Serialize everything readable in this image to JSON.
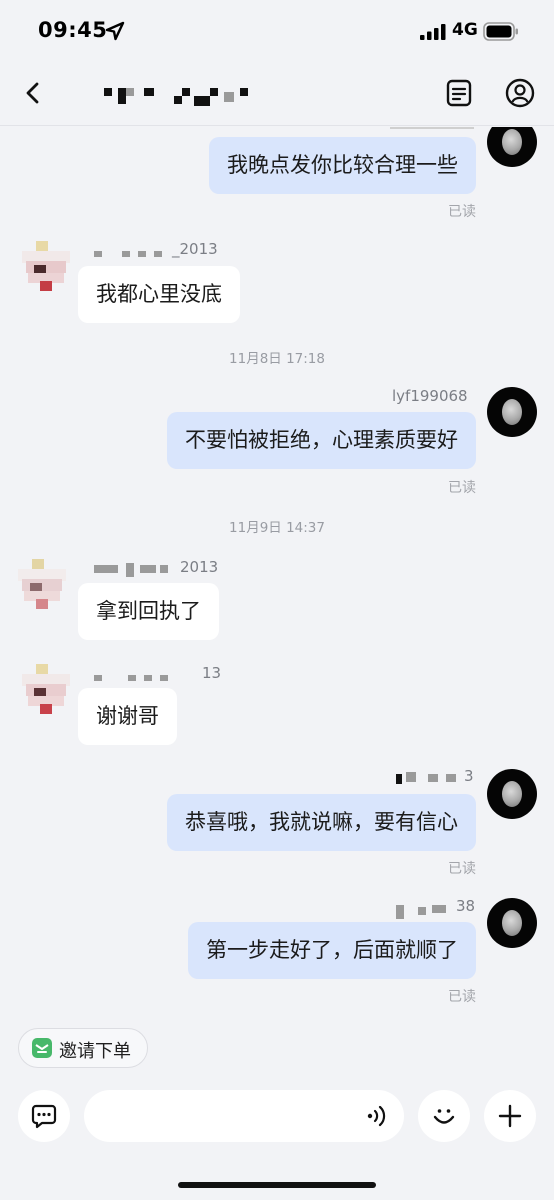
{
  "status_bar": {
    "time": "09:45",
    "network": "4G"
  },
  "chat": {
    "messages": [
      {
        "text": "我晚点发你比较合理一些",
        "status": "已读"
      },
      {
        "sender": "_2013",
        "text": "我都心里没底"
      },
      {
        "timestamp": "11月8日 17:18"
      },
      {
        "sender": "lyf199068",
        "text": "不要怕被拒绝，心理素质要好",
        "status": "已读"
      },
      {
        "timestamp": "11月9日 14:37"
      },
      {
        "sender": "2013",
        "text": "拿到回执了"
      },
      {
        "sender": "13",
        "text": "谢谢哥"
      },
      {
        "sender": "3",
        "text": "恭喜哦，我就说嘛，要有信心",
        "status": "已读"
      },
      {
        "sender": "38",
        "text": "第一步走好了，后面就顺了",
        "status": "已读"
      }
    ]
  },
  "bottom": {
    "invite_label": "邀请下单"
  },
  "colors": {
    "outgoing_bubble": "#d9e5fc",
    "incoming_bubble": "#ffffff",
    "background": "#f2f3f6",
    "invite_green": "#47b86a"
  },
  "icons": [
    "location-arrow-icon",
    "signal-icon",
    "battery-icon",
    "back-icon",
    "order-list-icon",
    "profile-icon",
    "invite-icon",
    "chat-bubble-icon",
    "voice-icon",
    "emoji-icon",
    "plus-icon"
  ]
}
